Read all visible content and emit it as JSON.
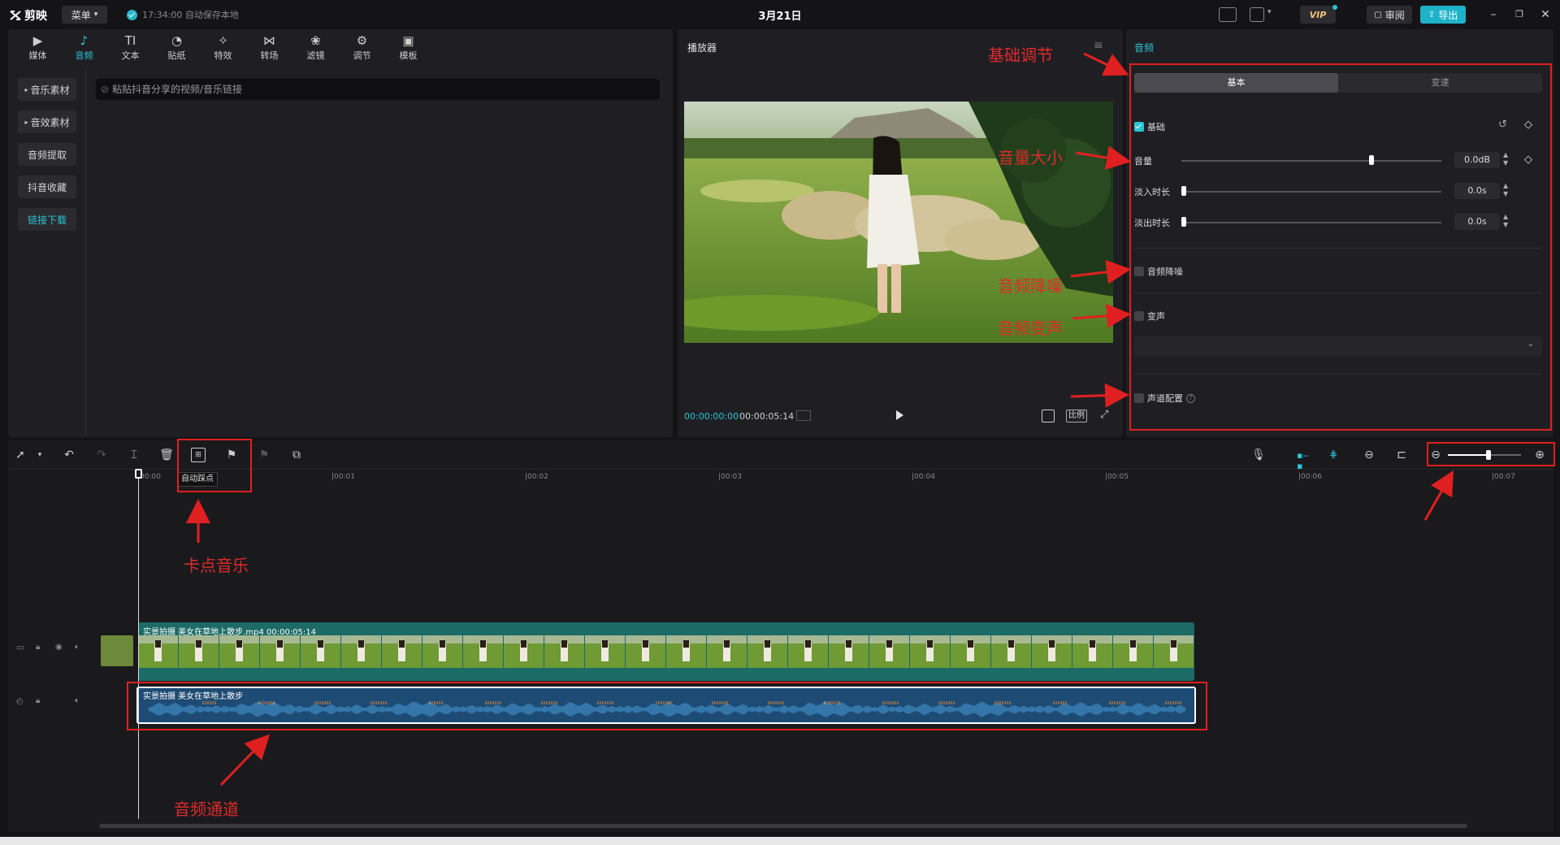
{
  "app": {
    "logo": "剪映",
    "menu_label": "菜单",
    "autosave": "17:34:00 自动保存本地",
    "doc_title": "3月21日",
    "vip": "VIP",
    "review": "审阅",
    "export": "导出"
  },
  "tool_tabs": [
    {
      "label": "媒体",
      "icon": "media-icon"
    },
    {
      "label": "音频",
      "icon": "audio-icon"
    },
    {
      "label": "文本",
      "icon": "text-icon"
    },
    {
      "label": "贴纸",
      "icon": "sticker-icon"
    },
    {
      "label": "特效",
      "icon": "effect-icon"
    },
    {
      "label": "转场",
      "icon": "transition-icon"
    },
    {
      "label": "滤镜",
      "icon": "filter-icon"
    },
    {
      "label": "调节",
      "icon": "adjust-icon"
    },
    {
      "label": "模板",
      "icon": "template-icon"
    }
  ],
  "side_list": [
    "音乐素材",
    "音效素材",
    "音频提取",
    "抖音收藏",
    "链接下载"
  ],
  "link_input": {
    "placeholder": "粘贴抖音分享的视频/音乐链接"
  },
  "player": {
    "title": "播放器",
    "time_current": "00:00:00:00",
    "time_total": "00:00:05:14",
    "ratio": "比例"
  },
  "audio_panel": {
    "title": "音频",
    "seg_basic": "基本",
    "seg_speed": "变速",
    "basic_label": "基础",
    "volume_label": "音量",
    "volume_value": "0.0dB",
    "volume_level": 0.73,
    "fade_in_label": "淡入时长",
    "fade_in_value": "0.0s",
    "fade_out_label": "淡出时长",
    "fade_out_value": "0.0s",
    "denoise_label": "音频降噪",
    "voice_change_label": "变声",
    "channel_label": "声道配置"
  },
  "annotations": {
    "basic_adjust": "基础调节",
    "volume_size": "音量大小",
    "audio_denoise": "音频降噪",
    "audio_voice": "音频变声",
    "beat_music": "卡点音乐",
    "audio_track": "音频通道"
  },
  "timeline": {
    "auto_beat_tooltip": "自动踩点",
    "ticks": [
      "00:00",
      "|00:01",
      "|00:02",
      "|00:03",
      "|00:04",
      "|00:05",
      "|00:06",
      "|00:07"
    ],
    "video_clip_label": "实景拍摄 美女在草地上散步.mp4   00:00:05:14",
    "audio_clip_label": "实景拍摄 美女在草地上散步",
    "zoom_level": 0.55
  },
  "colors": {
    "accent": "#2bc3d6",
    "annotation": "#e02020",
    "video_clip": "#1c6b66",
    "audio_clip": "#1e4b74"
  }
}
